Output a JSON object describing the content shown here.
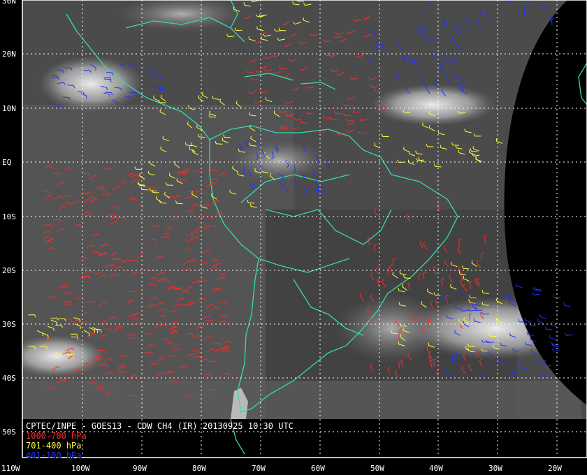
{
  "map": {
    "title": "CPTEC/INPE - GOES13 - CDW CH4 (IR) 20130925 10:30 UTC",
    "latitude_labels": [
      "30N",
      "20N",
      "10N",
      "EQ",
      "10S",
      "20S",
      "30S",
      "40S",
      "50S"
    ],
    "longitude_labels": [
      "110W",
      "100W",
      "90W",
      "80W",
      "70W",
      "60W",
      "50W",
      "40W",
      "30W",
      "20W"
    ],
    "legend": [
      {
        "label": "1000-700 hPa",
        "color": "#ff2a2a"
      },
      {
        "label": "701-400 hPa",
        "color": "#ffff33"
      },
      {
        "label": "401-100 hPa",
        "color": "#2233ff"
      }
    ],
    "coastline_color": "#33ddaa",
    "grid_color": "#ffffff"
  }
}
